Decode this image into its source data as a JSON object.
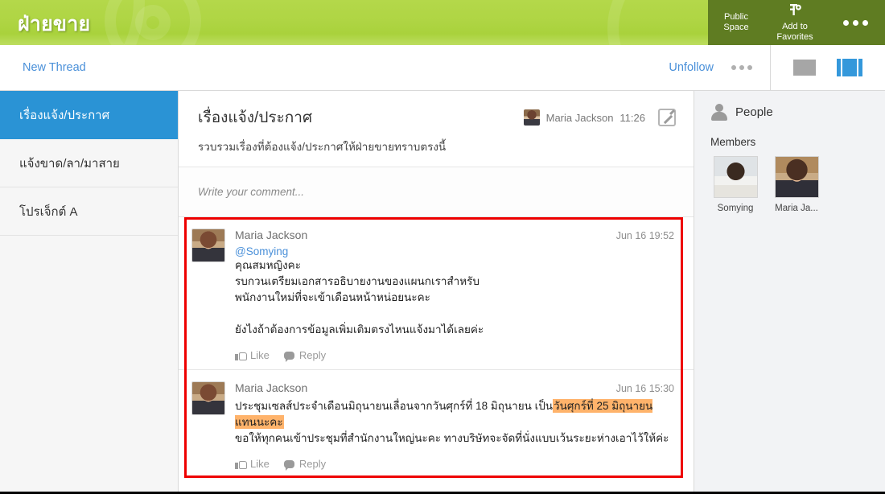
{
  "header": {
    "site_title": "ฝ่ายขาย",
    "public_space_line1": "Public",
    "public_space_line2": "Space",
    "add_favorites_line1": "Add to",
    "add_favorites_line2": "Favorites",
    "pin_glyph": "⚲",
    "green_accent": "#b0d64a",
    "dark_green": "#5f7c22"
  },
  "toolbar": {
    "new_thread_label": "New Thread",
    "unfollow_label": "Unfollow",
    "link_color": "#4a90d9",
    "active_view_color": "#3498db"
  },
  "sidebar": {
    "items": [
      {
        "label": "เรื่องแจ้ง/ประกาศ",
        "active": true
      },
      {
        "label": "แจ้งขาด/ลา/มาสาย",
        "active": false
      },
      {
        "label": "โปรเจ็กต์ A",
        "active": false
      }
    ],
    "active_color": "#2a93d5"
  },
  "thread": {
    "title": "เรื่องแจ้ง/ประกาศ",
    "subtitle": "รวบรวมเรื่องที่ต้องแจ้ง/ประกาศให้ฝ่ายขายทราบตรงนี้",
    "author": "Maria Jackson",
    "time": "11:26"
  },
  "comment_input": {
    "placeholder": "Write your comment..."
  },
  "posts": [
    {
      "author": "Maria Jackson",
      "time": "Jun 16 19:52",
      "mention": "@Somying",
      "lines": [
        "คุณสมหญิงคะ",
        "รบกวนเตรียมเอกสารอธิบายงานของแผนกเราสำหรับ",
        "พนักงานใหม่ที่จะเข้าเดือนหน้าหน่อยนะคะ",
        "",
        "ยังไงถ้าต้องการข้อมูลเพิ่มเติมตรงไหนแจ้งมาได้เลยค่ะ"
      ],
      "like_label": "Like",
      "reply_label": "Reply"
    },
    {
      "author": "Maria Jackson",
      "time": "Jun 16 15:30",
      "line1_before": "ประชุมเซลส์ประจำเดือนมิถุนายนเลื่อนจากวันศุกร์ที่ 18 มิถุนายน เป็น",
      "line1_highlight": "วันศุกร์ที่ 25 มิถุนายนแทนนะคะ",
      "line2": "ขอให้ทุกคนเข้าประชุมที่สำนักงานใหญ่นะคะ ทางบริษัทจะจัดที่นั่งแบบเว้นระยะห่างเอาไว้ให้ค่ะ",
      "highlight_color": "#ffb36b",
      "like_label": "Like",
      "reply_label": "Reply"
    }
  ],
  "people": {
    "title": "People",
    "members_label": "Members",
    "members": [
      {
        "name": "Somying"
      },
      {
        "name": "Maria Ja..."
      }
    ]
  },
  "selection": {
    "border_color": "#ee0000"
  }
}
